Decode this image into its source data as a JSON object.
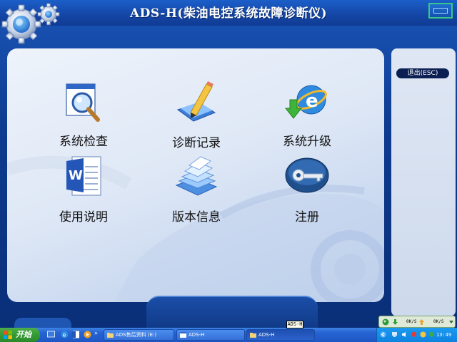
{
  "window": {
    "title": "ADS-H(柴油电控系统故障诊断仪)"
  },
  "menu": {
    "tiles": [
      {
        "label": "系统检查",
        "icon": "magnifier-search-icon"
      },
      {
        "label": "诊断记录",
        "icon": "pencil-notepad-icon"
      },
      {
        "label": "系统升级",
        "icon": "download-upgrade-icon"
      },
      {
        "label": "使用说明",
        "icon": "word-document-icon"
      },
      {
        "label": "版本信息",
        "icon": "document-stack-icon"
      },
      {
        "label": "注册",
        "icon": "key-icon"
      }
    ]
  },
  "sidebar": {
    "exit_label": "退出(ESC)"
  },
  "tooltip": {
    "text": "ADS-H"
  },
  "net_widget": {
    "down_speed": "0K/S",
    "up_speed": "0K/S"
  },
  "taskbar": {
    "start_label": "开始",
    "chevron": "»",
    "tasks": [
      {
        "label": "ADS售后资料 (E:)",
        "icon": "folder-icon"
      },
      {
        "label": "ADS-H",
        "icon": "app-window-icon"
      },
      {
        "label": "ADS-H",
        "icon": "folder-icon"
      }
    ],
    "clock": "13:49"
  },
  "colors": {
    "title_bar": "#1547a8",
    "panel_light": "#eef3fb",
    "accent_green": "#37c889",
    "start_green": "#369c36",
    "exit_dark": "#0b1f52"
  }
}
